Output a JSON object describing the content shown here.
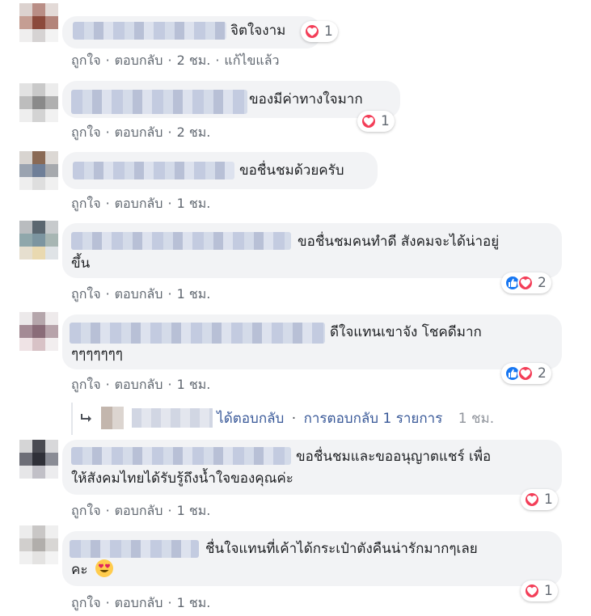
{
  "comments": [
    {
      "text1": "จิตใจงาม",
      "text2": "",
      "reactions": "1",
      "time": "2 ชม.",
      "edited": "แก้ไขแล้ว"
    },
    {
      "text1": "ของมีค่าทางใจมาก",
      "text2": "",
      "reactions": "1",
      "time": "2 ชม."
    },
    {
      "text1": "ขอชื่นชมด้วยครับ",
      "text2": "",
      "reactions": "",
      "time": "1 ชม."
    },
    {
      "text1": "ขอชื่นชมคนทำดี สังคมจะได้น่าอยู่",
      "text2": "ขึ้น",
      "reactions": "2",
      "time": "1 ชม."
    },
    {
      "text1": "ดีใจแทนเขาจัง โชคดีมาก",
      "text2": "ๆๆๆๆๆๆๆ",
      "reactions": "2",
      "time": "1 ชม."
    },
    {
      "text1": "ขอชื่นชมและขออนุญาตแชร์ เพื่อ",
      "text2": "ให้สังคมไทยได้รับรู้ถึงน้ำใจของคุณค่ะ",
      "reactions": "1",
      "time": "1 ชม."
    },
    {
      "text1": "ชื่นใจแทนที่เค้าได้กระเป๋าตังคืนน่ารักมากๆเลย",
      "text2": "คะ",
      "reactions": "1",
      "time": "1 ชม."
    }
  ],
  "actions": {
    "like": "ถูกใจ",
    "reply": "ตอบกลับ"
  },
  "view_replies": {
    "replied": "ได้ตอบกลับ",
    "count_text": "การตอบกลับ 1 รายการ",
    "time": "1 ชม."
  },
  "colors": {
    "love": "#f33e58",
    "like": "#1877f2",
    "bubble": "#f2f3f5",
    "meta": "#606770"
  },
  "icons": {
    "love": "heart-icon",
    "like": "thumbs-up-icon",
    "reply_arrow": "reply-arrow-icon",
    "emoji": "heart-eyes-emoji"
  }
}
